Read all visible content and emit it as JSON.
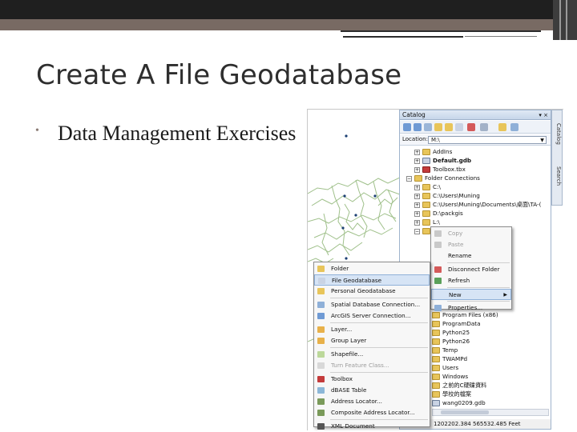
{
  "slide": {
    "title": "Create A File Geodatabase",
    "bullet": "Data Management Exercises"
  },
  "catalog": {
    "title": "Catalog",
    "title_buttons": "▾ ×",
    "location_label": "Location:",
    "location_value": "M:\\",
    "tree": [
      {
        "label": "AddIns",
        "icon": "folder-icon",
        "expander": "+"
      },
      {
        "label": "Default.gdb",
        "icon": "geodatabase-icon",
        "expander": "+",
        "bold": true
      },
      {
        "label": "Toolbox.tbx",
        "icon": "toolbox-icon",
        "expander": "+"
      },
      {
        "label": "Folder Connections",
        "icon": "folder-icon",
        "expander": "−"
      },
      {
        "label": "C:\\",
        "icon": "folder-icon",
        "expander": "+"
      },
      {
        "label": "C:\\Users\\Muning",
        "icon": "folder-icon",
        "expander": "+"
      },
      {
        "label": "C:\\Users\\Muning\\Documents\\桌面\\TA-(",
        "icon": "folder-icon",
        "expander": "+"
      },
      {
        "label": "D:\\packgis",
        "icon": "folder-icon",
        "expander": "+"
      },
      {
        "label": "L:\\",
        "icon": "folder-icon",
        "expander": "+"
      },
      {
        "label": "",
        "icon": "folder-icon",
        "expander": "−"
      }
    ],
    "lower_tree": [
      {
        "label": "Program Files (x86)",
        "icon": "folder-icon"
      },
      {
        "label": "ProgramData",
        "icon": "folder-icon"
      },
      {
        "label": "Python25",
        "icon": "folder-icon"
      },
      {
        "label": "Python26",
        "icon": "folder-icon"
      },
      {
        "label": "Temp",
        "icon": "folder-icon"
      },
      {
        "label": "TWAMPd",
        "icon": "folder-icon"
      },
      {
        "label": "Users",
        "icon": "folder-icon"
      },
      {
        "label": "Windows",
        "icon": "folder-icon"
      },
      {
        "label": "之前的C硬碟資料",
        "icon": "folder-icon"
      },
      {
        "label": "學校的檔案",
        "icon": "folder-icon"
      },
      {
        "label": "wang0209.gdb",
        "icon": "geodatabase-icon"
      }
    ],
    "status": "1202202.384  565532.485 Feet",
    "side_tabs": [
      "Catalog",
      "Search"
    ]
  },
  "context_menu": {
    "items": [
      {
        "label": "Copy",
        "disabled": true,
        "icon": "copy-icon"
      },
      {
        "label": "Paste",
        "disabled": true,
        "icon": "paste-icon"
      },
      {
        "label": "Rename",
        "disabled": false,
        "icon": ""
      },
      {
        "label": "Disconnect Folder",
        "disabled": false,
        "icon": "disconnect-icon"
      },
      {
        "label": "Refresh",
        "disabled": false,
        "icon": "refresh-icon"
      },
      {
        "label": "New",
        "disabled": false,
        "icon": "",
        "highlight": true,
        "submenu": true
      },
      {
        "label": "Properties...",
        "disabled": false,
        "icon": "properties-icon"
      }
    ]
  },
  "new_submenu": {
    "items": [
      {
        "label": "Folder",
        "icon": "folder-icon"
      },
      {
        "label": "File Geodatabase",
        "icon": "file-geodatabase-icon",
        "highlight": true
      },
      {
        "label": "Personal Geodatabase",
        "icon": "personal-geodatabase-icon"
      },
      {
        "label": "Spatial Database Connection...",
        "icon": "spatial-db-icon"
      },
      {
        "label": "ArcGIS Server Connection...",
        "icon": "server-icon"
      },
      {
        "label": "Layer...",
        "icon": "layer-icon"
      },
      {
        "label": "Group Layer",
        "icon": "group-layer-icon"
      },
      {
        "label": "Shapefile...",
        "icon": "shapefile-icon"
      },
      {
        "label": "Turn Feature Class...",
        "icon": "feature-class-icon",
        "disabled": true
      },
      {
        "label": "Toolbox",
        "icon": "toolbox-icon"
      },
      {
        "label": "dBASE Table",
        "icon": "dbase-icon"
      },
      {
        "label": "Address Locator...",
        "icon": "address-locator-icon"
      },
      {
        "label": "Composite Address Locator...",
        "icon": "composite-locator-icon"
      },
      {
        "label": "XML Document",
        "icon": "xml-icon"
      }
    ]
  },
  "colors": {
    "highlight": "#d6e4f5",
    "folder": "#e8c55a",
    "toolbox": "#c43b3b",
    "map_lines": "#9fc08a",
    "map_points": "#1c3f73"
  }
}
